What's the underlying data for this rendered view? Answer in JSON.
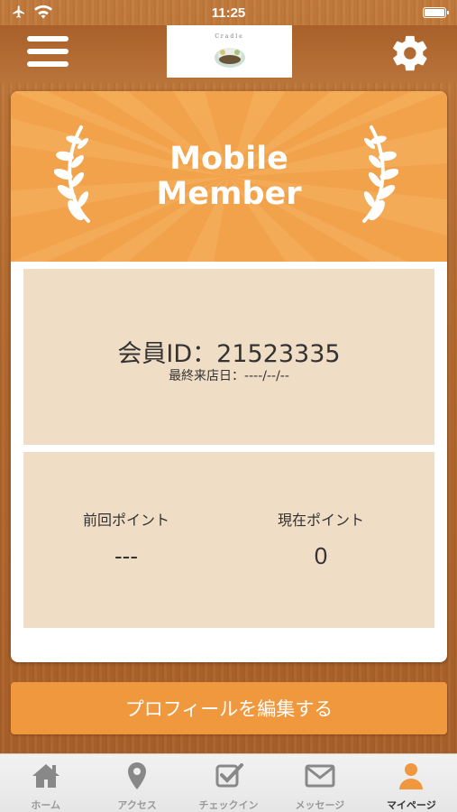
{
  "status_bar": {
    "time": "11:25"
  },
  "header": {
    "logo_text": "Cradle"
  },
  "banner": {
    "title_line1": "Mobile",
    "title_line2": "Member"
  },
  "member": {
    "id_label": "会員ID：21523335",
    "last_visit": "最終来店日：----/--/--"
  },
  "points": {
    "previous_label": "前回ポイント",
    "previous_value": "---",
    "current_label": "現在ポイント",
    "current_value": "0"
  },
  "edit_profile_label": "プロフィールを編集する",
  "tabs": [
    {
      "label": "ホーム",
      "icon": "home-icon"
    },
    {
      "label": "アクセス",
      "icon": "map-pin-icon"
    },
    {
      "label": "チェックイン",
      "icon": "checkin-icon"
    },
    {
      "label": "メッセージ",
      "icon": "mail-icon"
    },
    {
      "label": "マイページ",
      "icon": "user-icon",
      "active": true
    }
  ],
  "colors": {
    "accent": "#f0983e",
    "panel": "#f0ddc5",
    "banner": "#f2a24b",
    "wood": "#b36a2e"
  }
}
